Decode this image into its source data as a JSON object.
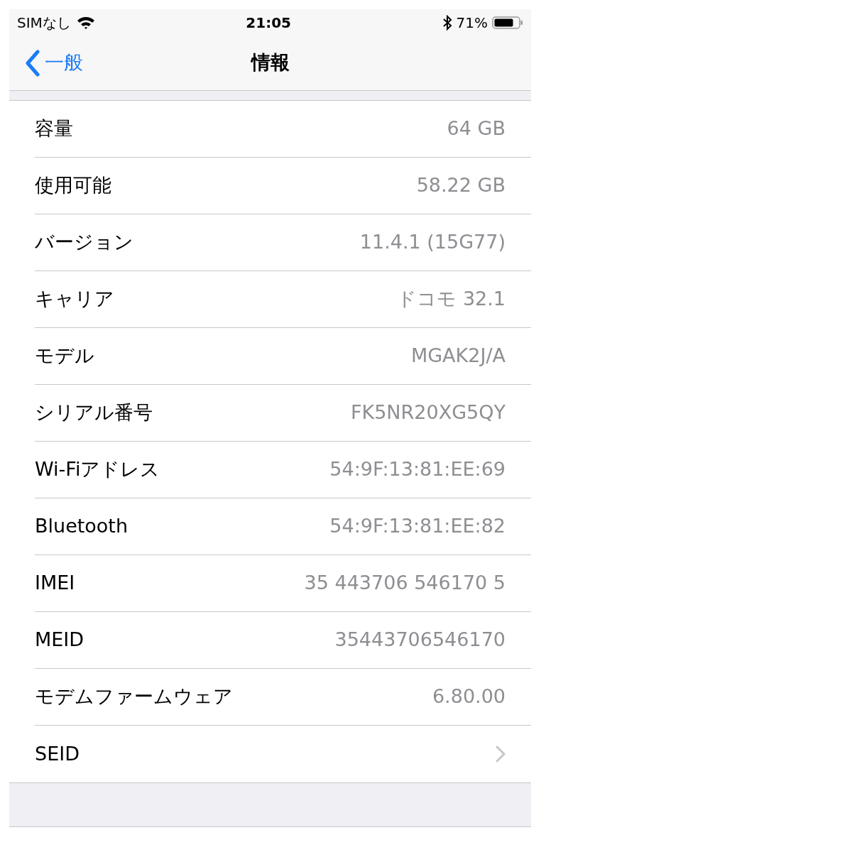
{
  "status_bar": {
    "carrier": "SIMなし",
    "time": "21:05",
    "battery": "71%"
  },
  "nav": {
    "back": "一般",
    "title": "情報"
  },
  "rows": [
    {
      "kind": "value",
      "label": "容量",
      "value": "64 GB"
    },
    {
      "kind": "value",
      "label": "使用可能",
      "value": "58.22 GB"
    },
    {
      "kind": "value",
      "label": "バージョン",
      "value": "11.4.1 (15G77)"
    },
    {
      "kind": "value",
      "label": "キャリア",
      "value": "ドコモ 32.1"
    },
    {
      "kind": "value",
      "label": "モデル",
      "value": "MGAK2J/A"
    },
    {
      "kind": "value",
      "label": "シリアル番号",
      "value": "FK5NR20XG5QY"
    },
    {
      "kind": "value",
      "label": "Wi-Fiアドレス",
      "value": "54:9F:13:81:EE:69"
    },
    {
      "kind": "value",
      "label": "Bluetooth",
      "value": "54:9F:13:81:EE:82"
    },
    {
      "kind": "value",
      "label": "IMEI",
      "value": "35 443706 546170 5"
    },
    {
      "kind": "value",
      "label": "MEID",
      "value": "35443706546170"
    },
    {
      "kind": "value",
      "label": "モデムファームウェア",
      "value": "6.80.00"
    },
    {
      "kind": "link",
      "label": "SEID"
    }
  ]
}
